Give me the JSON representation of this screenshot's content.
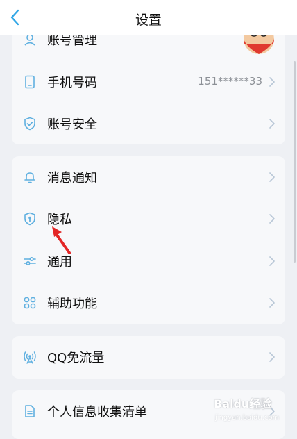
{
  "header": {
    "title": "设置"
  },
  "groups": [
    {
      "items": [
        {
          "label": "账号管理",
          "icon": "user-icon"
        },
        {
          "label": "手机号码",
          "value": "151******33",
          "icon": "phone-icon"
        },
        {
          "label": "账号安全",
          "icon": "shield-check-icon"
        }
      ]
    },
    {
      "items": [
        {
          "label": "消息通知",
          "icon": "bell-icon"
        },
        {
          "label": "隐私",
          "icon": "privacy-shield-icon"
        },
        {
          "label": "通用",
          "icon": "sliders-icon"
        },
        {
          "label": "辅助功能",
          "icon": "grid-icon"
        }
      ]
    },
    {
      "items": [
        {
          "label": "QQ免流量",
          "icon": "signal-icon"
        }
      ]
    },
    {
      "items": [
        {
          "label": "个人信息收集清单",
          "icon": "document-icon"
        }
      ]
    }
  ],
  "watermark": {
    "text": "Baidu经验",
    "sub": "jingyan.baidu.com"
  },
  "colors": {
    "icon": "#5fb0e0",
    "chevron": "#b8c7d6",
    "annotation_arrow": "#e32626"
  }
}
